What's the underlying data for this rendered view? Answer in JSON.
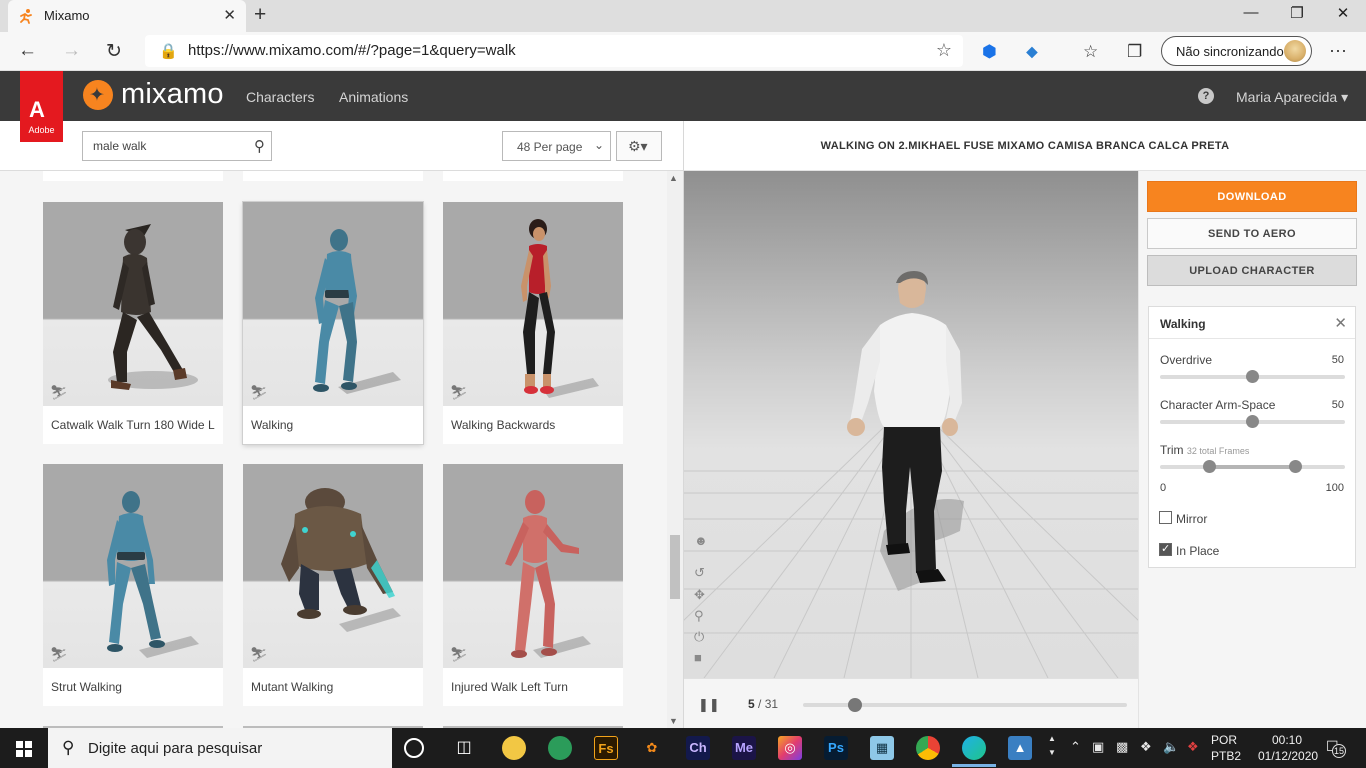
{
  "browser": {
    "tab_title": "Mixamo",
    "tab_close": "✕",
    "new_tab": "+",
    "window_buttons": {
      "minimize": "—",
      "maximize": "❐",
      "close": "✕"
    },
    "url": "https://www.mixamo.com/#/?page=1&query=walk",
    "sync_label": "Não sincronizando",
    "more": "···"
  },
  "header": {
    "adobe_label": "Adobe",
    "logo_text": "mixamo",
    "nav": [
      "Characters",
      "Animations"
    ],
    "user": "Maria Aparecida",
    "help": "?"
  },
  "search": {
    "value": "male walk",
    "per_page": "48 Per page"
  },
  "cards": [
    {
      "label": "Catwalk Walk Turn 180 Wide L",
      "selected": false
    },
    {
      "label": "Walking",
      "selected": true
    },
    {
      "label": "Walking Backwards",
      "selected": false
    },
    {
      "label": "Strut Walking",
      "selected": false
    },
    {
      "label": "Mutant Walking",
      "selected": false
    },
    {
      "label": "Injured Walk Left Turn",
      "selected": false
    }
  ],
  "viewer": {
    "title": "WALKING ON 2.MIKHAEL FUSE MIXAMO CAMISA BRANCA CALCA PRETA",
    "current_frame": "5",
    "total_frames_label": "/ 31",
    "progress": 0.16
  },
  "actions": {
    "download": "DOWNLOAD",
    "send_to_aero": "SEND TO AERO",
    "upload_character": "UPLOAD CHARACTER"
  },
  "animation_panel": {
    "title": "Walking",
    "overdrive_label": "Overdrive",
    "overdrive_value": "50",
    "arm_space_label": "Character Arm-Space",
    "arm_space_value": "50",
    "trim_label": "Trim",
    "trim_frames": "32 total Frames",
    "trim_min": "0",
    "trim_max": "100",
    "mirror_label": "Mirror",
    "mirror_checked": false,
    "inplace_label": "In Place",
    "inplace_checked": true
  },
  "taskbar": {
    "search_placeholder": "Digite aqui para pesquisar",
    "apps": [
      "Fs",
      "Ch",
      "Me",
      "Ps"
    ],
    "lang_line1": "POR",
    "lang_line2": "PTB2",
    "time": "00:10",
    "date": "01/12/2020",
    "notifications": "15"
  },
  "colors": {
    "accent": "#f7841f",
    "header_bg": "#3a3a3a",
    "adobe_red": "#e4191f"
  }
}
